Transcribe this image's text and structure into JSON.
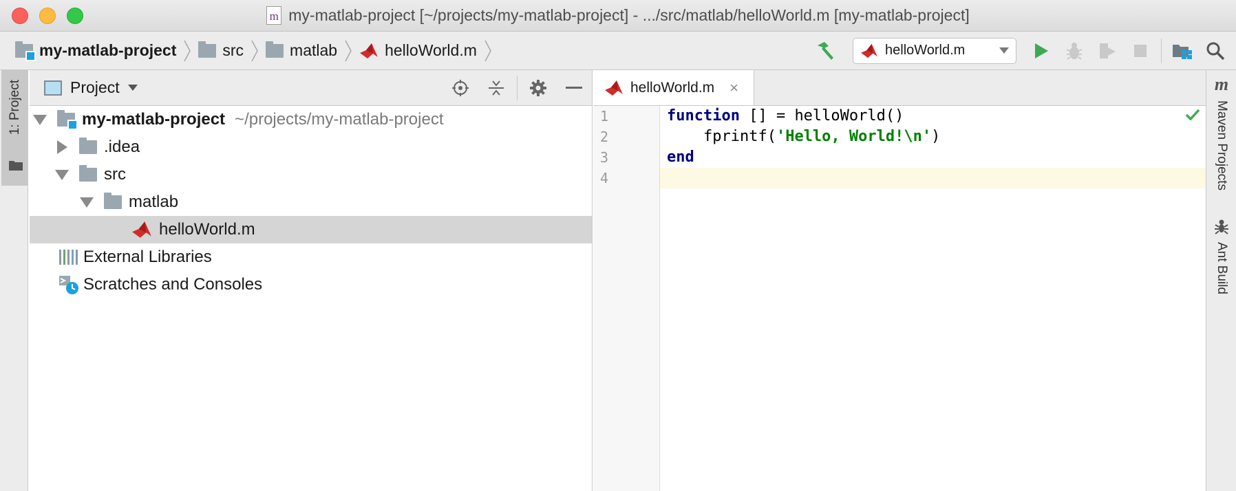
{
  "window": {
    "title": "my-matlab-project [~/projects/my-matlab-project] - .../src/matlab/helloWorld.m [my-matlab-project]",
    "file_icon_letter": "m"
  },
  "navbar": {
    "breadcrumbs": [
      "my-matlab-project",
      "src",
      "matlab",
      "helloWorld.m"
    ],
    "run_config": "helloWorld.m"
  },
  "left_strip": {
    "tab_label": "1: Project"
  },
  "project_panel": {
    "title": "Project",
    "tree": [
      {
        "label": "my-matlab-project",
        "path": "~/projects/my-matlab-project"
      },
      {
        "label": ".idea"
      },
      {
        "label": "src"
      },
      {
        "label": "matlab"
      },
      {
        "label": "helloWorld.m"
      },
      {
        "label": "External Libraries"
      },
      {
        "label": "Scratches and Consoles"
      }
    ]
  },
  "editor": {
    "tab_label": "helloWorld.m",
    "close_glyph": "×",
    "line_numbers": [
      "1",
      "2",
      "3",
      "4"
    ],
    "code": {
      "l1_kw": "function",
      "l1_rest": " [] = helloWorld()",
      "l2_indent_call": "    fprintf(",
      "l2_str": "'Hello, World!\\n'",
      "l2_close": ")",
      "l3_kw": "end"
    },
    "current_line": "4"
  },
  "right_strip": {
    "maven_label": "Maven Projects",
    "maven_icon_letter": "m",
    "ant_label": "Ant Build"
  },
  "colors": {
    "matlab_red": "#d22b2b",
    "run_green": "#3daa53",
    "folder_grey": "#9aa7b0",
    "project_blue": "#1ba1e2",
    "keyword": "#000080",
    "string": "#008000"
  }
}
